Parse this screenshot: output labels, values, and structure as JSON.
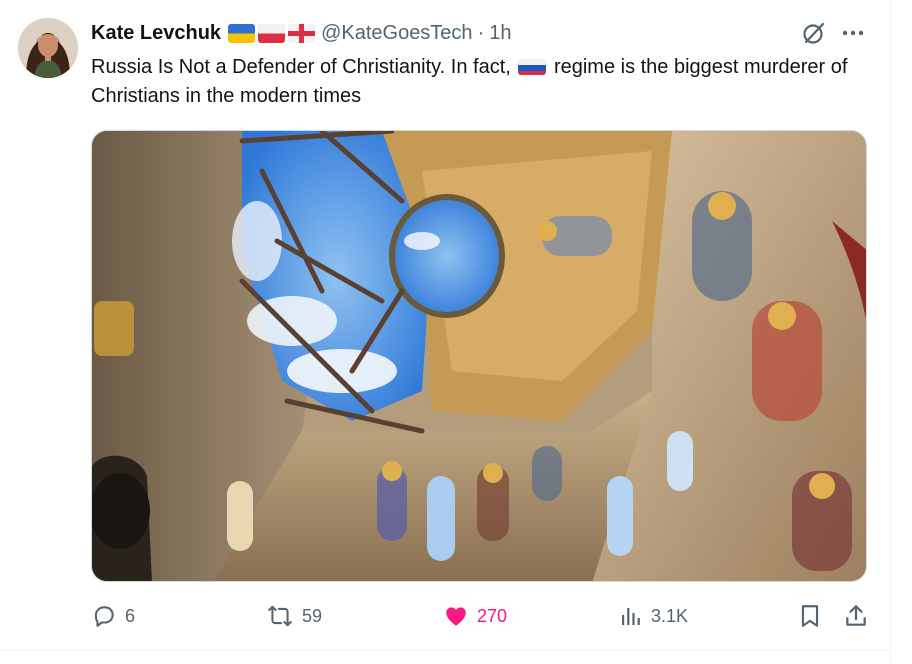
{
  "author": {
    "name": "Kate Levchuk",
    "handle": "@KateGoesTech",
    "time": "1h",
    "flags": [
      "ukraine-flag",
      "poland-flag",
      "england-flag"
    ]
  },
  "tweet": {
    "text_part1": "Russia Is Not a Defender of Christianity. In fact,",
    "inline_flag": "russia-flag",
    "text_part2": "regime is the biggest murderer of Christians in the modern times"
  },
  "separator": "·",
  "actions": {
    "replies": "6",
    "reposts": "59",
    "likes": "270",
    "views": "3.1K"
  },
  "colors": {
    "text": "#0f1419",
    "secondary": "#536471",
    "like": "#f91880",
    "border": "#cfd9de"
  },
  "icons": {
    "more": "more-icon",
    "grok": "grok-icon",
    "reply": "reply-icon",
    "repost": "repost-icon",
    "like": "heart-icon",
    "views": "views-icon",
    "bookmark": "bookmark-icon",
    "share": "share-icon"
  }
}
